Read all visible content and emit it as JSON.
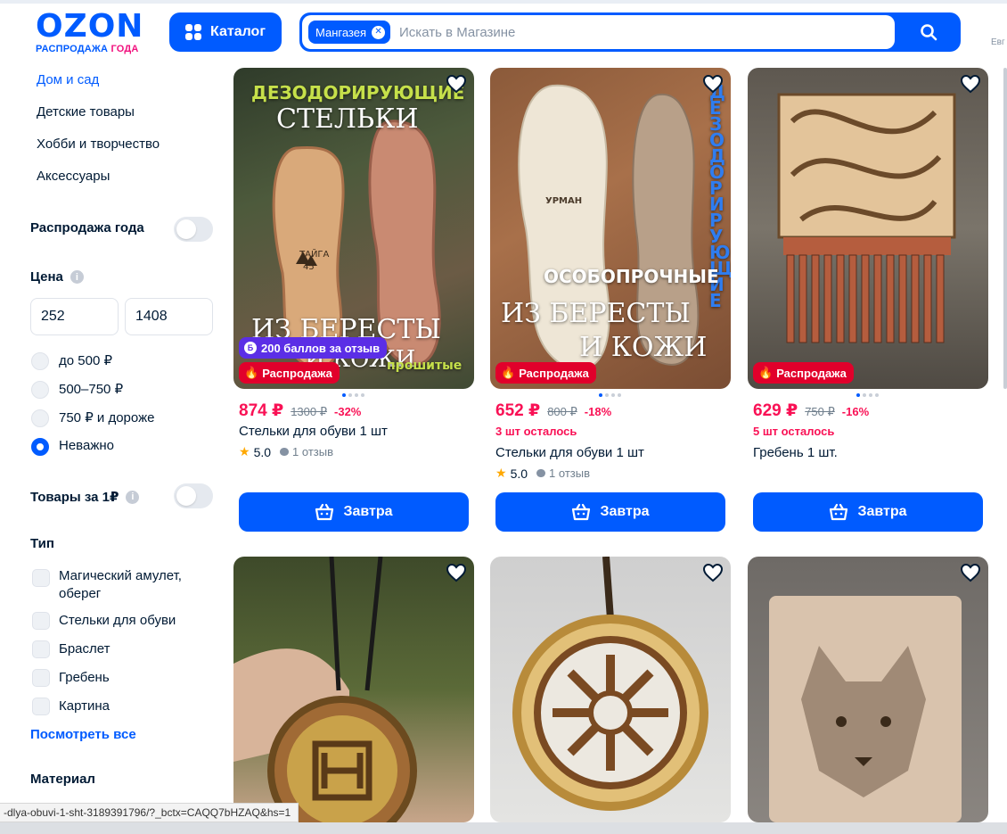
{
  "header": {
    "logo_text": "OZON",
    "logo_sub_blue": "РАСПРОДАЖА",
    "logo_sub_pink": "ГОДА",
    "catalog_label": "Каталог",
    "shop_chip": "Мангазея",
    "search_placeholder": "Искать в Магазине",
    "right_cut_text": "Евг"
  },
  "sidebar": {
    "categories": [
      {
        "label": "Дом и сад",
        "active": true
      },
      {
        "label": "Детские товары",
        "active": false
      },
      {
        "label": "Хобби и творчество",
        "active": false
      },
      {
        "label": "Аксессуары",
        "active": false
      }
    ],
    "sale_toggle_label": "Распродажа года",
    "price_title": "Цена",
    "price_from": "252",
    "price_to": "1408",
    "price_options": [
      {
        "label": "до 500 ₽",
        "checked": false
      },
      {
        "label": "500–750 ₽",
        "checked": false
      },
      {
        "label": "750 ₽ и дороже",
        "checked": false
      },
      {
        "label": "Неважно",
        "checked": true
      }
    ],
    "one_ruble_label": "Товары за 1₽",
    "type_title": "Тип",
    "type_options": [
      {
        "label": "Магический амулет, оберег"
      },
      {
        "label": "Стельки для обуви"
      },
      {
        "label": "Браслет"
      },
      {
        "label": "Гребень"
      },
      {
        "label": "Картина"
      }
    ],
    "see_all": "Посмотреть все",
    "material_title": "Материал"
  },
  "products": [
    {
      "image_texts": [
        "ДЕЗОДОРИРУЮЩИЕ",
        "СТЕЛЬКИ",
        "ИЗ БЕРЕСТЫ",
        "И КОЖИ",
        "прошитые",
        "ТАЙГА",
        "45"
      ],
      "points_badge": "200 баллов за отзыв",
      "sale_badge": "Распродажа",
      "price": "874 ₽",
      "old_price": "1300 ₽",
      "discount": "-32%",
      "stock": "",
      "title": "Стельки для обуви 1 шт",
      "rating": "5.0",
      "reviews": "1 отзыв",
      "button": "Завтра"
    },
    {
      "image_texts": [
        "ДЕЗОДОРИРУЮЩИЕ",
        "ОСОБОПРОЧНЫЕ",
        "ИЗ БЕРЕСТЫ",
        "И КОЖИ",
        "УРМАН"
      ],
      "sale_badge": "Распродажа",
      "price": "652 ₽",
      "old_price": "800 ₽",
      "discount": "-18%",
      "stock": "3 шт осталось",
      "title": "Стельки для обуви 1 шт",
      "rating": "5.0",
      "reviews": "1 отзыв",
      "button": "Завтра"
    },
    {
      "sale_badge": "Распродажа",
      "price": "629 ₽",
      "old_price": "750 ₽",
      "discount": "-16%",
      "stock": "5 шт осталось",
      "title": "Гребень 1 шт.",
      "button": "Завтра"
    }
  ],
  "status_url": "-dlya-obuvi-1-sht-3189391796/?_bctx=CAQQ7bHZAQ&hs=1",
  "colors": {
    "brand_blue": "#005bff",
    "price_pink": "#f91155",
    "sale_red": "#e1002b",
    "points_purple": "#5b2ee6"
  }
}
